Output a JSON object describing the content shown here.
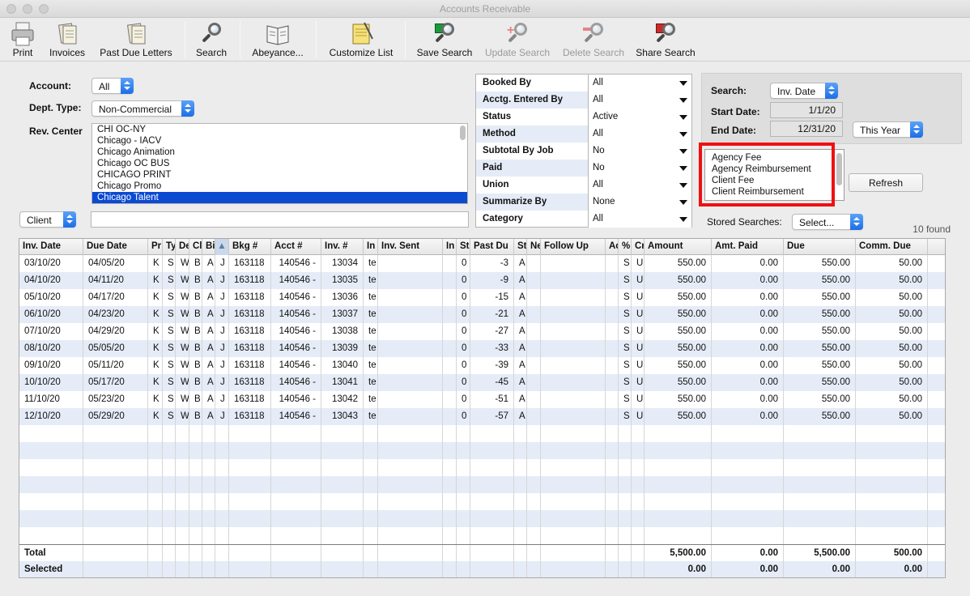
{
  "window": {
    "title": "Accounts Receivable"
  },
  "toolbar": [
    {
      "label": "Print",
      "icon": "printer-icon",
      "enabled": true
    },
    {
      "label": "Invoices",
      "icon": "invoice-icon",
      "enabled": true
    },
    {
      "label": "Past Due Letters",
      "icon": "letters-icon",
      "enabled": true
    },
    {
      "label": "Search",
      "icon": "magnifier-icon",
      "enabled": true
    },
    {
      "label": "Abeyance...",
      "icon": "book-icon",
      "enabled": true
    },
    {
      "label": "Customize List",
      "icon": "notepad-icon",
      "enabled": true
    },
    {
      "label": "Save Search",
      "icon": "save-search-icon",
      "enabled": true
    },
    {
      "label": "Update Search",
      "icon": "update-search-icon",
      "enabled": false
    },
    {
      "label": "Delete Search",
      "icon": "delete-search-icon",
      "enabled": false
    },
    {
      "label": "Share Search",
      "icon": "share-search-icon",
      "enabled": true
    }
  ],
  "form": {
    "account_label": "Account:",
    "account_value": "All",
    "dept_label": "Dept. Type:",
    "dept_value": "Non-Commercial",
    "rev_label": "Rev. Center",
    "rev_items": [
      "CHI OC-NY",
      "Chicago - IACV",
      "Chicago Animation",
      "Chicago OC BUS",
      "CHICAGO PRINT",
      "Chicago Promo",
      "Chicago Talent"
    ],
    "rev_selected": 6,
    "client_popup": "Client",
    "client_value": ""
  },
  "filters": [
    {
      "label": "Booked By",
      "value": "All"
    },
    {
      "label": "Acctg. Entered By",
      "value": "All"
    },
    {
      "label": "Status",
      "value": "Active"
    },
    {
      "label": "Method",
      "value": "All"
    },
    {
      "label": "Subtotal By Job",
      "value": "No"
    },
    {
      "label": "Paid",
      "value": "No"
    },
    {
      "label": "Union",
      "value": "All"
    },
    {
      "label": "Summarize By",
      "value": "None"
    },
    {
      "label": "Category",
      "value": "All"
    }
  ],
  "search": {
    "search_label": "Search:",
    "search_value": "Inv. Date",
    "start_label": "Start Date:",
    "start_value": "1/1/20",
    "end_label": "End Date:",
    "end_value": "12/31/20",
    "range_value": "This Year",
    "types": [
      "Agency Fee",
      "Agency Reimbursement",
      "Client Fee",
      "Client Reimbursement"
    ],
    "refresh_label": "Refresh",
    "stored_label": "Stored Searches:",
    "stored_value": "Select...",
    "found": "10 found"
  },
  "table": {
    "columns": [
      "Inv. Date",
      "Due Date",
      "Pr",
      "Ty",
      "De",
      "Cl",
      "Bi",
      "▲",
      "Bkg #",
      "Acct #",
      "Inv. #",
      "In",
      "Inv. Sent",
      "In",
      "St",
      "Past Du",
      "St",
      "Ne",
      "Follow Up",
      "Ac",
      "%",
      "Cr",
      "Amount",
      "Amt. Paid",
      "Due",
      "Comm. Due"
    ],
    "rows": [
      [
        "03/10/20",
        "04/05/20",
        "K",
        "S",
        "W",
        "B",
        "A",
        "J",
        "163118",
        "140546 -",
        "13034",
        "te",
        "",
        "",
        "0",
        "-3",
        "A",
        "",
        "",
        "",
        "S",
        "U",
        "550.00",
        "0.00",
        "550.00",
        "50.00"
      ],
      [
        "04/10/20",
        "04/11/20",
        "K",
        "S",
        "W",
        "B",
        "A",
        "J",
        "163118",
        "140546 -",
        "13035",
        "te",
        "",
        "",
        "0",
        "-9",
        "A",
        "",
        "",
        "",
        "S",
        "U",
        "550.00",
        "0.00",
        "550.00",
        "50.00"
      ],
      [
        "05/10/20",
        "04/17/20",
        "K",
        "S",
        "W",
        "B",
        "A",
        "J",
        "163118",
        "140546 -",
        "13036",
        "te",
        "",
        "",
        "0",
        "-15",
        "A",
        "",
        "",
        "",
        "S",
        "U",
        "550.00",
        "0.00",
        "550.00",
        "50.00"
      ],
      [
        "06/10/20",
        "04/23/20",
        "K",
        "S",
        "W",
        "B",
        "A",
        "J",
        "163118",
        "140546 -",
        "13037",
        "te",
        "",
        "",
        "0",
        "-21",
        "A",
        "",
        "",
        "",
        "S",
        "U",
        "550.00",
        "0.00",
        "550.00",
        "50.00"
      ],
      [
        "07/10/20",
        "04/29/20",
        "K",
        "S",
        "W",
        "B",
        "A",
        "J",
        "163118",
        "140546 -",
        "13038",
        "te",
        "",
        "",
        "0",
        "-27",
        "A",
        "",
        "",
        "",
        "S",
        "U",
        "550.00",
        "0.00",
        "550.00",
        "50.00"
      ],
      [
        "08/10/20",
        "05/05/20",
        "K",
        "S",
        "W",
        "B",
        "A",
        "J",
        "163118",
        "140546 -",
        "13039",
        "te",
        "",
        "",
        "0",
        "-33",
        "A",
        "",
        "",
        "",
        "S",
        "U",
        "550.00",
        "0.00",
        "550.00",
        "50.00"
      ],
      [
        "09/10/20",
        "05/11/20",
        "K",
        "S",
        "W",
        "B",
        "A",
        "J",
        "163118",
        "140546 -",
        "13040",
        "te",
        "",
        "",
        "0",
        "-39",
        "A",
        "",
        "",
        "",
        "S",
        "U",
        "550.00",
        "0.00",
        "550.00",
        "50.00"
      ],
      [
        "10/10/20",
        "05/17/20",
        "K",
        "S",
        "W",
        "B",
        "A",
        "J",
        "163118",
        "140546 -",
        "13041",
        "te",
        "",
        "",
        "0",
        "-45",
        "A",
        "",
        "",
        "",
        "S",
        "U",
        "550.00",
        "0.00",
        "550.00",
        "50.00"
      ],
      [
        "11/10/20",
        "05/23/20",
        "K",
        "S",
        "W",
        "B",
        "A",
        "J",
        "163118",
        "140546 -",
        "13042",
        "te",
        "",
        "",
        "0",
        "-51",
        "A",
        "",
        "",
        "",
        "S",
        "U",
        "550.00",
        "0.00",
        "550.00",
        "50.00"
      ],
      [
        "12/10/20",
        "05/29/20",
        "K",
        "S",
        "W",
        "B",
        "A",
        "J",
        "163118",
        "140546 -",
        "13043",
        "te",
        "",
        "",
        "0",
        "-57",
        "A",
        "",
        "",
        "",
        "S",
        "U",
        "550.00",
        "0.00",
        "550.00",
        "50.00"
      ]
    ],
    "total_label": "Total",
    "total": [
      "5,500.00",
      "0.00",
      "5,500.00",
      "500.00"
    ],
    "selected_label": "Selected",
    "selected": [
      "0.00",
      "0.00",
      "0.00",
      "0.00"
    ]
  },
  "colors": {
    "selection": "#0b4ad1",
    "alt_row": "#e5ecf7",
    "highlight_box": "#ee1111",
    "popup_accent": "#1c6ee6"
  }
}
